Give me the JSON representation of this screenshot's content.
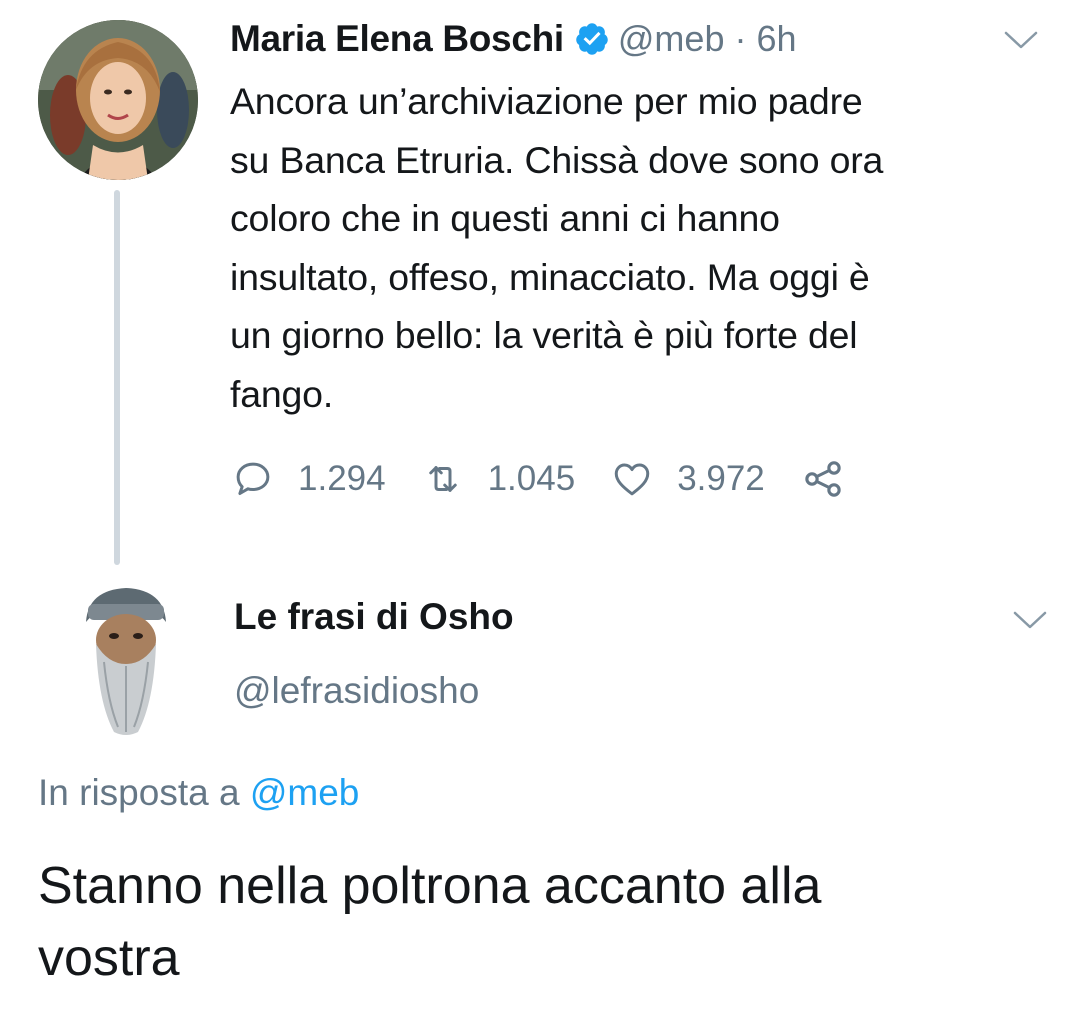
{
  "original_tweet": {
    "author_name": "Maria Elena Boschi",
    "verified_icon": "verified-badge-icon",
    "handle": "@meb",
    "separator": "·",
    "time": "6h",
    "menu_icon": "chevron-down-icon",
    "text_lines": [
      "Ancora un’archiviazione per mio padre",
      "su Banca Etruria. Chissà dove sono ora",
      "coloro che in questi anni ci hanno",
      "insultato, offeso, minacciato. Ma oggi è",
      "un giorno bello: la verità è più forte del",
      "fango."
    ],
    "actions": {
      "replies": "1.294",
      "retweets": "1.045",
      "likes": "3.972",
      "reply_icon": "comment-icon",
      "retweet_icon": "retweet-icon",
      "like_icon": "heart-icon",
      "share_icon": "share-icon"
    }
  },
  "reply_tweet": {
    "author_name": "Le frasi di Osho",
    "handle": "@lefrasidiosho",
    "menu_icon": "chevron-down-icon",
    "in_reply_to_prefix": "In risposta a",
    "in_reply_to_mention": "@meb",
    "text_lines": [
      "Stanno nella poltrona accanto alla",
      "vostra"
    ]
  },
  "colors": {
    "text_primary": "#14171a",
    "text_secondary": "#657786",
    "link": "#1da1f2",
    "verified": "#1da1f2",
    "thread_line": "#cfd7de"
  }
}
